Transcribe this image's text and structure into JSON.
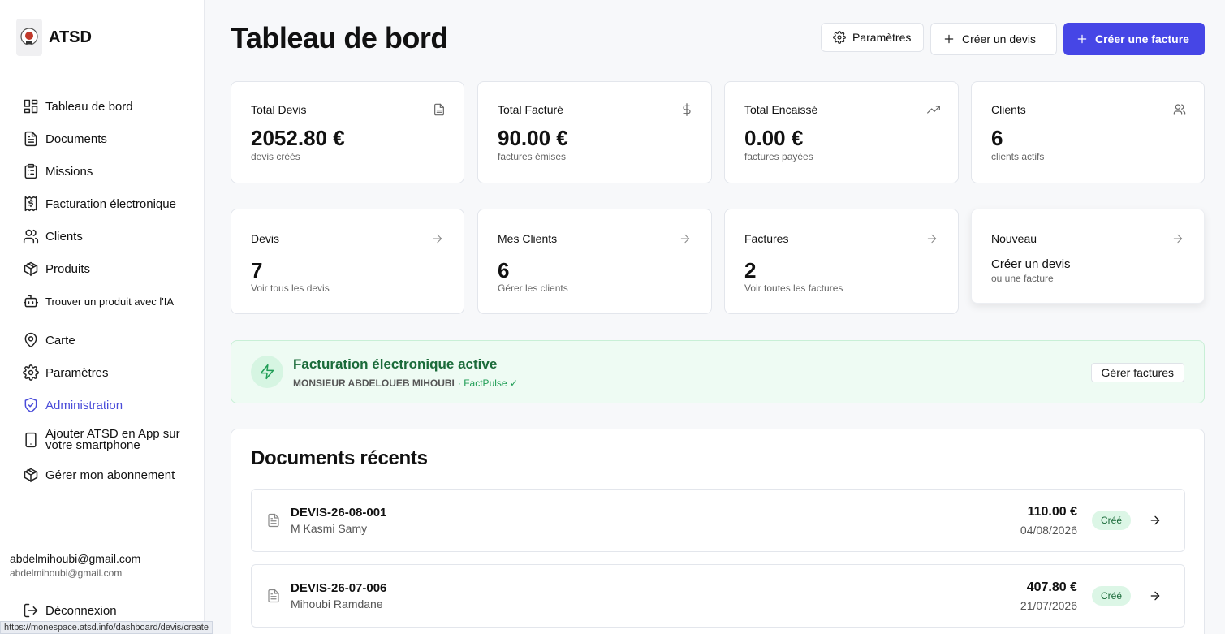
{
  "brand": {
    "name": "ATSD"
  },
  "sidebar": {
    "items": [
      {
        "label": "Tableau de bord",
        "icon": "layout-grid-icon"
      },
      {
        "label": "Documents",
        "icon": "file-text-icon"
      },
      {
        "label": "Missions",
        "icon": "clipboard-list-icon"
      },
      {
        "label": "Facturation électronique",
        "icon": "receipt-dollar-icon"
      },
      {
        "label": "Clients",
        "icon": "users-icon"
      },
      {
        "label": "Produits",
        "icon": "package-icon"
      },
      {
        "label": "Trouver un produit avec l'IA",
        "icon": "bot-icon"
      },
      {
        "label": "Carte",
        "icon": "map-pin-icon"
      },
      {
        "label": "Paramètres",
        "icon": "gear-icon"
      },
      {
        "label": "Administration",
        "icon": "shield-check-icon",
        "active": true
      },
      {
        "label": "Ajouter ATSD en App sur votre smartphone",
        "icon": "smartphone-icon"
      },
      {
        "label": "Gérer mon abonnement",
        "icon": "package-icon"
      }
    ],
    "active_color": "#4a4cd9"
  },
  "user": {
    "email": "abdelmihoubi@gmail.com",
    "sub": "abdelmihoubi@gmail.com",
    "logout_label": "Déconnexion"
  },
  "status_url": "https://monespace.atsd.info/dashboard/devis/create",
  "header": {
    "title": "Tableau de bord",
    "settings_label": "Paramètres",
    "create_devis_label": "Créer un devis",
    "create_facture_label": "Créer une facture",
    "accent": "#4646e6"
  },
  "stats": [
    {
      "label": "Total Devis",
      "value": "2052.80 €",
      "sub": "devis créés",
      "icon": "file-text-icon"
    },
    {
      "label": "Total Facturé",
      "value": "90.00 €",
      "sub": "factures émises",
      "icon": "dollar-icon"
    },
    {
      "label": "Total Encaissé",
      "value": "0.00 €",
      "sub": "factures payées",
      "icon": "trending-up-icon"
    },
    {
      "label": "Clients",
      "value": "6",
      "sub": "clients actifs",
      "icon": "users-icon"
    }
  ],
  "quick": [
    {
      "label": "Devis",
      "value": "7",
      "sub": "Voir tous les devis"
    },
    {
      "label": "Mes Clients",
      "value": "6",
      "sub": "Gérer les clients"
    },
    {
      "label": "Factures",
      "value": "2",
      "sub": "Voir toutes les factures"
    },
    {
      "label": "Nouveau",
      "title": "Créer un devis",
      "sub": "ou une facture"
    }
  ],
  "banner": {
    "title": "Facturation électronique active",
    "name": "MONSIEUR ABDELOUEB MIHOUBI",
    "provider": "· FactPulse ✓",
    "button": "Gérer factures",
    "color": "#1f9d55"
  },
  "recent": {
    "title": "Documents récents",
    "rows": [
      {
        "number": "DEVIS-26-08-001",
        "client": "M Kasmi Samy",
        "amount": "110.00 €",
        "date": "04/08/2026",
        "status": "Créé"
      },
      {
        "number": "DEVIS-26-07-006",
        "client": "Mihoubi Ramdane",
        "amount": "407.80 €",
        "date": "21/07/2026",
        "status": "Créé"
      }
    ]
  }
}
